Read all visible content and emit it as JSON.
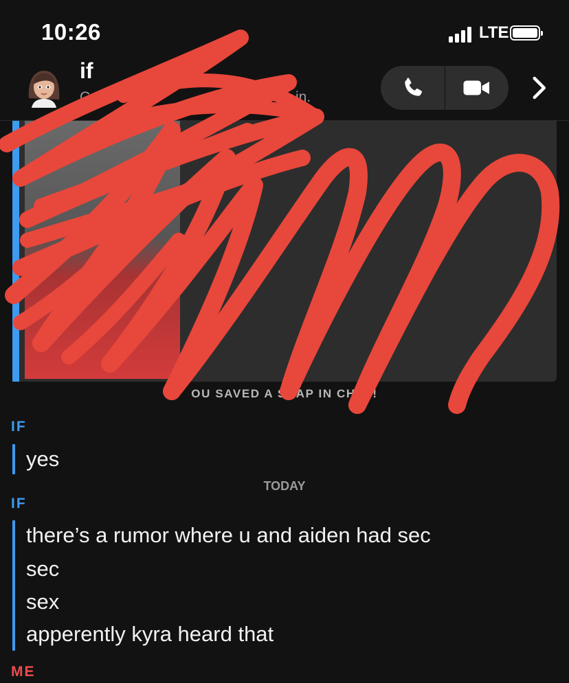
{
  "status_bar": {
    "time": "10:26",
    "network": "LTE"
  },
  "header": {
    "title": "if",
    "subtitle_start": "C",
    "subtitle_end": "in.",
    "icons": [
      "avatar",
      "phone-icon",
      "video-icon",
      "chevron-right-icon"
    ]
  },
  "chat": {
    "saved_notice": "OU SAVED A SNAP IN CHAT!",
    "day_label": "TODAY",
    "groups": [
      {
        "sender": "IF",
        "messages": [
          "yes"
        ]
      },
      {
        "sender": "IF",
        "messages": [
          "there’s a rumor where u and aiden had sec",
          "sec",
          "sex",
          "apperently kyra heard that"
        ]
      },
      {
        "sender": "ME",
        "messages": []
      }
    ]
  },
  "colors": {
    "friend_accent": "#3d9bf0",
    "me_accent": "#ec4d4d",
    "scribble": "#e8473b",
    "background": "#121212"
  }
}
